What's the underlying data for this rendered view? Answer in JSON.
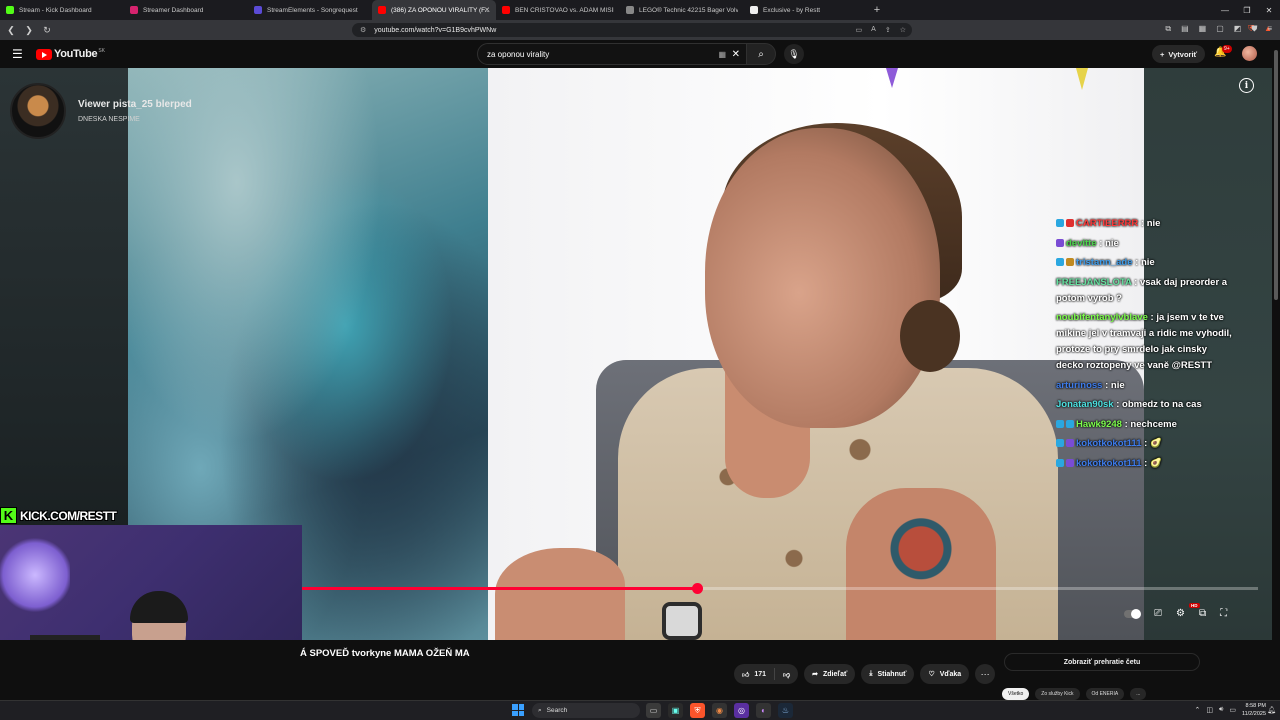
{
  "browser": {
    "tabs": [
      {
        "label": "Stream - Kick Dashboard",
        "color": "#53fc18",
        "active": false
      },
      {
        "label": "Streamer Dashboard",
        "color": "#d6236e",
        "active": false
      },
      {
        "label": "StreamElements - Songrequest",
        "color": "#5b4bd6",
        "active": false
      },
      {
        "label": "(386) ZA OPONOU VIRALITY (F...",
        "color": "#ff0000",
        "active": true
      },
      {
        "label": "BEN CRISTOVAO vs. ADAM MIŠÍK na",
        "color": "#ff0000",
        "active": false
      },
      {
        "label": "LEGO® Technic 42215 Bager Volvo E",
        "color": "#888888",
        "active": false
      },
      {
        "label": "Exclusive - by Restt",
        "color": "#eeeeee",
        "active": false
      }
    ],
    "new_tab": "+",
    "window_controls": [
      "—",
      "❐",
      "✕"
    ],
    "url": "youtube.com/watch?v=G1B9cvhPWNw"
  },
  "youtube": {
    "logo_text": "YouTube",
    "region": "SK",
    "search_value": "za oponou virality",
    "create_label": "Vytvoriť",
    "notif_count": "9+",
    "video_title": "Á SPOVEĎ tvorkyne MAMA OŽEŇ MA",
    "like_count": "171",
    "share_label": "Zdieľať",
    "download_label": "Stiahnuť",
    "thanks_label": "Vďaka",
    "replay_chat_label": "Zobraziť prehratie četu",
    "chips": [
      "Všetko",
      "Zo služby Kick",
      "Od ENERIA",
      "..."
    ],
    "progress_fraction": 0.413
  },
  "alert": {
    "title": "Viewer pista_25 blerped",
    "subtitle": "DNESKA NESPIME"
  },
  "chat": [
    {
      "user": "CARTIEERRR",
      "user_color": "#ff3b3b",
      "text": "nie",
      "badges": [
        "#2aa7e0",
        "#e03030"
      ]
    },
    {
      "user": "devitte",
      "user_color": "#4cd44c",
      "text": "nie",
      "badges": [
        "#7a4cd4"
      ]
    },
    {
      "user": "tristann_ade",
      "user_color": "#3d9be9",
      "text": "nie",
      "badges": [
        "#2aa7e0",
        "#c08a20"
      ]
    },
    {
      "user": "FREEJANSLOTA",
      "user_color": "#66e0a0",
      "text": "vsak daj preorder a potom vyrob ?",
      "badges": []
    },
    {
      "user": "noubifentanylvblave",
      "user_color": "#7cfc4c",
      "text": "ja jsem v te tve mikine jel v tramvaji a ridic me vyhodil, protoze to pry smrdelo jak cinsky decko roztopeny ve vaně @RESTT",
      "badges": []
    },
    {
      "user": "arturinoss",
      "user_color": "#3d7be9",
      "text": "nie",
      "badges": []
    },
    {
      "user": "Jonatan90sk",
      "user_color": "#4ce0e0",
      "text": "obmedz to na cas",
      "badges": []
    },
    {
      "user": "Hawk9248",
      "user_color": "#7cfc4c",
      "text": "nechceme",
      "badges": [
        "#2aa7e0",
        "#2aa7e0"
      ]
    },
    {
      "user": "kokotkokot111",
      "user_color": "#3d7be9",
      "text": "🥑",
      "badges": [
        "#2aa7e0",
        "#7a4cd4"
      ]
    },
    {
      "user": "kokotkokot111",
      "user_color": "#3d7be9",
      "text": "🥑",
      "badges": [
        "#2aa7e0",
        "#7a4cd4"
      ]
    }
  ],
  "kick": {
    "logo_letter": "K",
    "banner_text": "KICK.COM/RESTT"
  },
  "taskbar": {
    "search_label": "Search",
    "time": "8:58 PM",
    "date": "11/2/2025"
  }
}
